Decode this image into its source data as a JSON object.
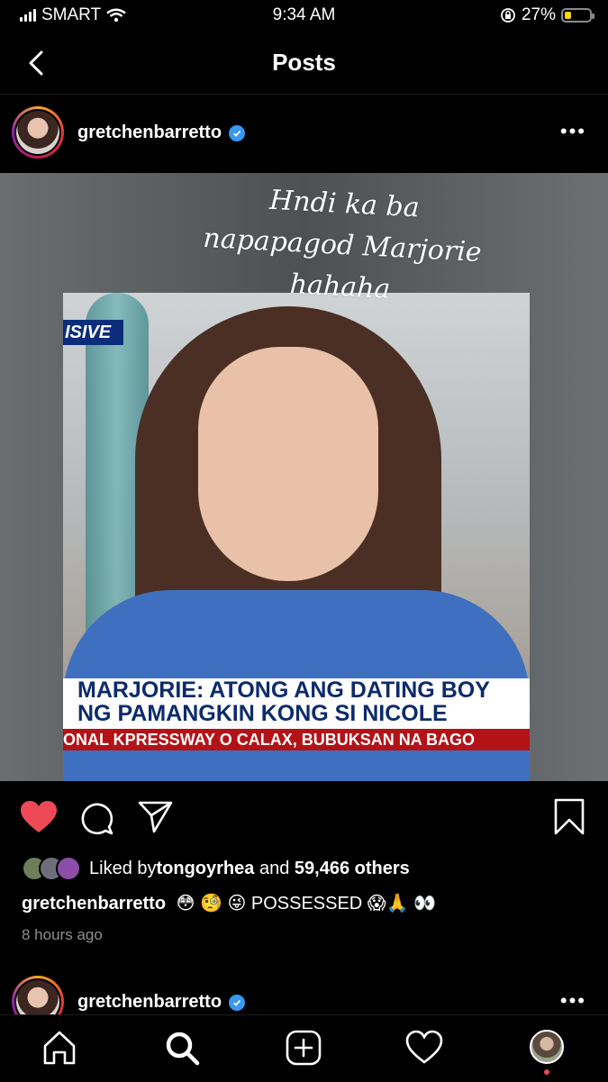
{
  "status_bar": {
    "carrier": "SMART",
    "time": "9:34 AM",
    "battery": "27%",
    "battery_level": 0.27
  },
  "header": {
    "title": "Posts"
  },
  "post": {
    "username": "gretchenbarretto",
    "image": {
      "overlay_text": [
        "Hndi ka ba",
        "napapagod Marjorie",
        "hahaha"
      ],
      "tag": "ISIVE",
      "lower_third": [
        "MARJORIE: ATONG ANG DATING BOY",
        "NG PAMANGKIN KONG SI NICOLE"
      ],
      "ticker": "ONAL KPRESSWAY O CALAX, BUBUKSAN NA BAGO"
    },
    "likes": {
      "prefix": "Liked by ",
      "user": "tongoyrhea",
      "middle": " and ",
      "count": "59,466 others"
    },
    "caption": {
      "username": "gretchenbarretto",
      "text": "😳 🧐 😜 POSSESSED 😱🙏 👀"
    },
    "time_ago": "8 hours ago",
    "liked": true,
    "like_color": "#ed4956"
  },
  "next_post": {
    "username": "gretchenbarretto"
  },
  "colors": {
    "verified": "#3897f0",
    "background": "#000000"
  },
  "tab_bar": {
    "items": [
      "home-icon",
      "search-icon",
      "add-post-icon",
      "activity-heart-icon",
      "profile-avatar"
    ],
    "active": "search-icon"
  }
}
